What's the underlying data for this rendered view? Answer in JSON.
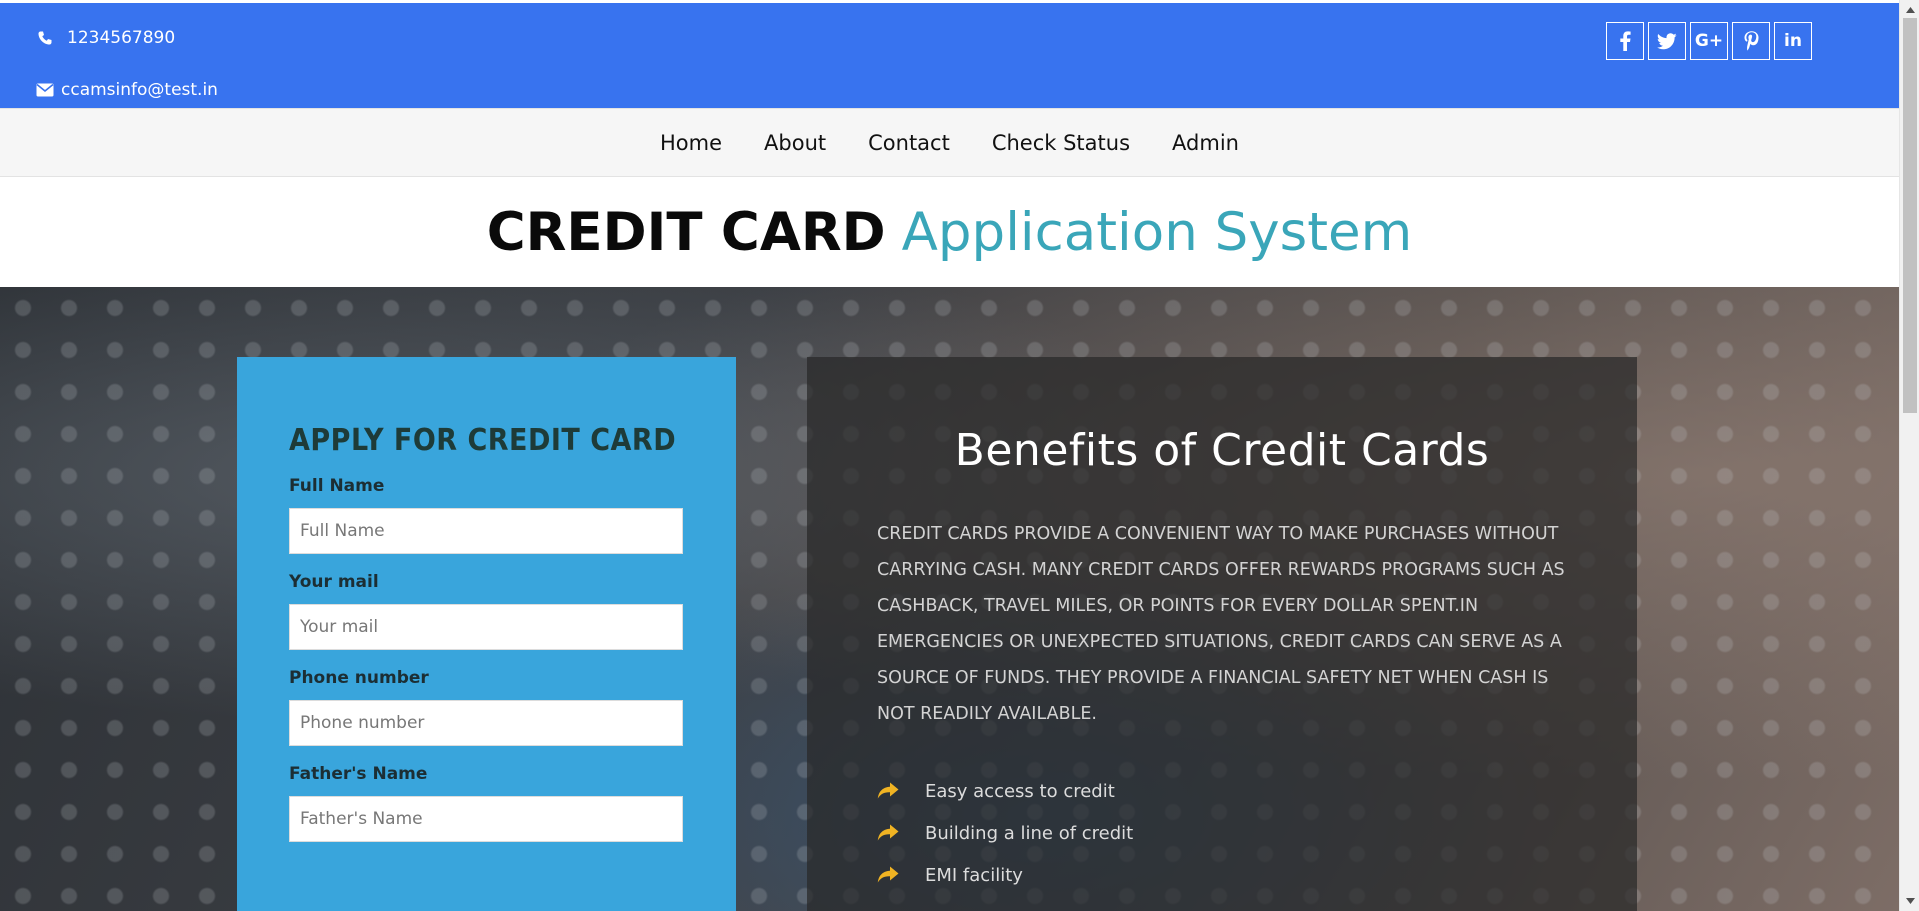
{
  "topbar": {
    "phone": "1234567890",
    "email": "ccamsinfo@test.in",
    "social": [
      {
        "icon": "facebook-icon",
        "glyph": "f"
      },
      {
        "icon": "twitter-icon",
        "glyph": ""
      },
      {
        "icon": "google-plus-icon",
        "glyph": "G+"
      },
      {
        "icon": "pinterest-icon",
        "glyph": ""
      },
      {
        "icon": "linkedin-icon",
        "glyph": "in"
      }
    ]
  },
  "nav": {
    "items": [
      "Home",
      "About",
      "Contact",
      "Check Status",
      "Admin"
    ]
  },
  "title": {
    "part1": "CREDIT CARD",
    "part2": "Application System"
  },
  "form": {
    "heading": "APPLY FOR CREDIT CARD",
    "fields": [
      {
        "label": "Full Name",
        "placeholder": "Full Name"
      },
      {
        "label": "Your mail",
        "placeholder": "Your mail"
      },
      {
        "label": "Phone number",
        "placeholder": "Phone number"
      },
      {
        "label": "Father's Name",
        "placeholder": "Father's Name"
      }
    ]
  },
  "benefits": {
    "heading": "Benefits of Credit Cards",
    "text": "Credit cards provide a convenient way to make purchases without carrying cash. Many credit cards offer rewards programs such as cashback, travel miles, or points for every dollar spent.In emergencies or unexpected situations, credit cards can serve as a source of funds. They provide a financial safety net when cash is not readily available.",
    "items": [
      "Easy access to credit",
      "Building a line of credit",
      "EMI facility"
    ]
  },
  "colors": {
    "topbar": "#3873ef",
    "form_panel": "#39a5dc",
    "title_accent": "#3aa6b9",
    "arrow": "#f0b323"
  }
}
